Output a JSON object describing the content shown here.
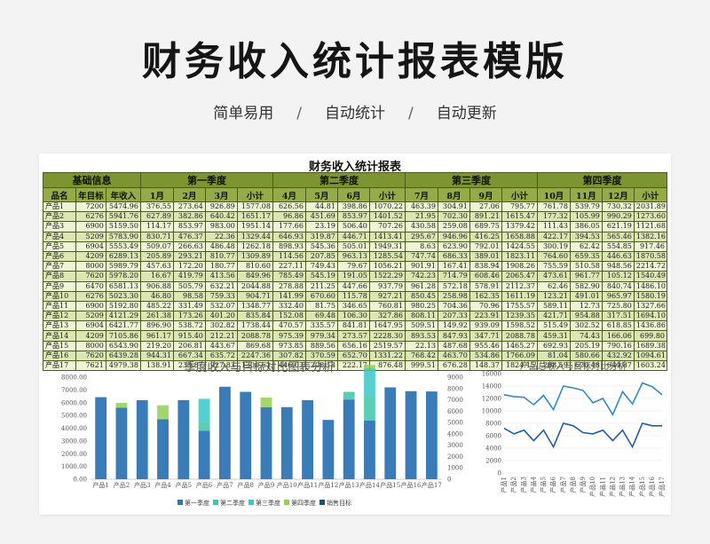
{
  "page": {
    "title": "财务收入统计报表模版",
    "features": [
      "简单易用",
      "自动统计",
      "自动更新"
    ],
    "separator": "/"
  },
  "sheet": {
    "title": "财务收入统计报表",
    "groups": [
      "基础信息",
      "第一季度",
      "第二季度",
      "第三季度",
      "第四季度"
    ],
    "columns": [
      "品名",
      "年目标",
      "年收入",
      "1月",
      "2月",
      "3月",
      "小计",
      "4月",
      "5月",
      "6月",
      "小计",
      "7月",
      "8月",
      "9月",
      "小计",
      "10月",
      "11月",
      "12月",
      "小计"
    ],
    "rows": [
      [
        "产品1",
        "7200",
        "5474.96",
        "376.55",
        "273.64",
        "926.89",
        "1577.08",
        "626.56",
        "44.81",
        "398.86",
        "1070.22",
        "463.39",
        "304.91",
        "27.06",
        "795.77",
        "761.78",
        "539.79",
        "730.32",
        "2031.89"
      ],
      [
        "产品2",
        "6276",
        "5941.76",
        "627.89",
        "382.86",
        "640.42",
        "1651.17",
        "96.86",
        "451.69",
        "853.97",
        "1401.52",
        "21.95",
        "702.30",
        "891.21",
        "1615.47",
        "177.32",
        "105.99",
        "990.29",
        "1273.60"
      ],
      [
        "产品3",
        "6900",
        "5159.50",
        "114.17",
        "853.97",
        "983.00",
        "1951.14",
        "177.66",
        "23.19",
        "506.40",
        "707.26",
        "430.58",
        "259.08",
        "689.75",
        "1379.42",
        "111.43",
        "386.05",
        "621.19",
        "1121.68"
      ],
      [
        "产品4",
        "5209",
        "5783.90",
        "830.71",
        "476.37",
        "22.36",
        "1329.44",
        "646.93",
        "319.87",
        "446.71",
        "1413.41",
        "295.67",
        "946.96",
        "416.25",
        "1658.88",
        "422.17",
        "394.53",
        "565.46",
        "1382.16"
      ],
      [
        "产品5",
        "6904",
        "5553.49",
        "509.07",
        "266.63",
        "486.48",
        "1262.18",
        "898.93",
        "545.36",
        "505.01",
        "1949.31",
        "8.63",
        "623.90",
        "792.01",
        "1424.55",
        "300.19",
        "62.42",
        "554.85",
        "917.46"
      ],
      [
        "产品6",
        "4209",
        "6289.13",
        "205.89",
        "293.21",
        "810.77",
        "1309.89",
        "114.56",
        "207.85",
        "963.13",
        "1285.54",
        "747.74",
        "686.33",
        "389.01",
        "1823.11",
        "764.60",
        "659.35",
        "446.63",
        "1870.58"
      ],
      [
        "产品7",
        "8000",
        "5989.79",
        "457.63",
        "172.20",
        "180.77",
        "810.60",
        "227.11",
        "749.43",
        "79.67",
        "1056.21",
        "901.91",
        "167.41",
        "838.94",
        "1908.26",
        "755.59",
        "510.58",
        "948.56",
        "2214.72"
      ],
      [
        "产品8",
        "7620",
        "5978.20",
        "16.67",
        "419.79",
        "413.56",
        "849.96",
        "785.49",
        "545.19",
        "191.05",
        "1522.29",
        "742.23",
        "714.79",
        "608.46",
        "2065.47",
        "473.61",
        "961.77",
        "105.12",
        "1540.49"
      ],
      [
        "产品9",
        "6470",
        "6581.13",
        "906.88",
        "505.79",
        "632.21",
        "2044.88",
        "278.88",
        "211.25",
        "447.66",
        "937.79",
        "961.28",
        "572.18",
        "578.91",
        "2112.37",
        "62.46",
        "582.90",
        "840.74",
        "1486.10"
      ],
      [
        "产品10",
        "6276",
        "5023.30",
        "46.80",
        "98.58",
        "759.33",
        "904.71",
        "141.99",
        "670.60",
        "115.78",
        "927.21",
        "850.45",
        "258.98",
        "162.35",
        "1611.19",
        "123.21",
        "491.01",
        "965.97",
        "1580.19"
      ],
      [
        "产品11",
        "6900",
        "5192.80",
        "485.22",
        "331.49",
        "532.07",
        "1348.77",
        "332.40",
        "81.75",
        "346.65",
        "760.81",
        "980.25",
        "704.36",
        "70.96",
        "1755.57",
        "589.11",
        "12.73",
        "725.80",
        "1327.66"
      ],
      [
        "产品12",
        "5209",
        "4121.29",
        "261.38",
        "173.26",
        "401.20",
        "835.84",
        "152.08",
        "69.48",
        "106.30",
        "327.86",
        "808.11",
        "207.33",
        "223.91",
        "1239.35",
        "421.71",
        "954.88",
        "317.51",
        "1694.10"
      ],
      [
        "产品13",
        "6904",
        "6421.77",
        "896.90",
        "538.72",
        "302.82",
        "1738.44",
        "470.57",
        "335.57",
        "841.81",
        "1647.95",
        "509.51",
        "149.92",
        "939.09",
        "1598.52",
        "515.49",
        "302.52",
        "618.85",
        "1436.86"
      ],
      [
        "产品14",
        "4209",
        "7105.86",
        "961.17",
        "915.40",
        "212.21",
        "2088.78",
        "975.39",
        "979.34",
        "273.57",
        "2228.30",
        "893.53",
        "847.93",
        "347.71",
        "2088.78",
        "459.31",
        "74.43",
        "166.06",
        "699.80"
      ],
      [
        "产品15",
        "8000",
        "6543.90",
        "219.20",
        "206.81",
        "443.67",
        "869.68",
        "973.85",
        "889.56",
        "656.16",
        "2519.57",
        "22.13",
        "487.68",
        "955.46",
        "1465.27",
        "692.93",
        "205.19",
        "790.16",
        "1689.38"
      ],
      [
        "产品16",
        "7620",
        "6439.28",
        "944.31",
        "667.34",
        "635.72",
        "2247.36",
        "307.82",
        "370.59",
        "652.70",
        "1331.22",
        "768.42",
        "463.70",
        "534.86",
        "1766.09",
        "81.04",
        "580.66",
        "432.92",
        "1094.61"
      ],
      [
        "产品17",
        "7621",
        "4979.38",
        "138.91",
        "233.87",
        "927.83",
        "1300.61",
        "446.03",
        "208.18",
        "222.17",
        "876.48",
        "999.51",
        "676.28",
        "148.37",
        "1824.15",
        "288.59",
        "670.48",
        "644.87",
        "1603.24"
      ]
    ]
  },
  "chart_data": [
    {
      "type": "bar",
      "title": "季度收入与目标对比图表分析",
      "categories": [
        "产品1",
        "产品2",
        "产品3",
        "产品4",
        "产品5",
        "产品6",
        "产品7",
        "产品8",
        "产品9",
        "产品10",
        "产品11",
        "产品12",
        "产品13",
        "产品14",
        "产品15",
        "产品16",
        "产品17"
      ],
      "series": [
        {
          "name": "第一季度",
          "color": "#2e75b6",
          "values": [
            6430,
            5600,
            6200,
            4700,
            6200,
            3800,
            7250,
            6850,
            5650,
            5650,
            6200,
            4650,
            6250,
            4600,
            7200,
            6900,
            6880
          ]
        },
        {
          "name": "第二季度",
          "color": "#3cc6a8",
          "values": [
            0,
            0,
            0,
            0,
            0,
            700,
            0,
            0,
            0,
            0,
            0,
            0,
            600,
            1800,
            0,
            0,
            0
          ]
        },
        {
          "name": "第三季度",
          "color": "#36c9c6",
          "values": [
            0,
            0,
            0,
            0,
            0,
            1800,
            0,
            0,
            0,
            0,
            0,
            0,
            0,
            2300,
            0,
            0,
            0
          ]
        },
        {
          "name": "第四季度",
          "color": "#92d050",
          "values": [
            0,
            380,
            0,
            1100,
            0,
            0,
            0,
            0,
            750,
            0,
            0,
            0,
            0,
            250,
            0,
            0,
            0
          ]
        },
        {
          "name": "销售目标",
          "color": "#1f4e79",
          "values": [
            0,
            0,
            0,
            0,
            0,
            0,
            0,
            0,
            0,
            0,
            0,
            0,
            0,
            0,
            0,
            0,
            0
          ]
        }
      ],
      "y_left": {
        "ticks": [
          "0.00",
          "1000.00",
          "2000.00",
          "3000.00",
          "4000.00",
          "5000.00",
          "6000.00",
          "7000.00",
          "8000.00"
        ],
        "range": [
          0,
          8000
        ]
      },
      "y_right": {
        "ticks": [
          "0",
          "1000",
          "2000",
          "3000",
          "4000",
          "5000",
          "6000",
          "7000",
          "8000",
          "9000"
        ],
        "range": [
          0,
          9000
        ]
      },
      "legend": "bottom"
    },
    {
      "type": "line",
      "title": "产品总收入与目标对比分析",
      "categories": [
        "产品1",
        "产品2",
        "产品3",
        "产品4",
        "产品5",
        "产品6",
        "产品7",
        "产品8",
        "产品9",
        "产品10",
        "产品11",
        "产品12",
        "产品13",
        "产品14",
        "产品15",
        "产品16",
        "产品17"
      ],
      "series": [
        {
          "color": "#2e8bc9",
          "values": [
            12600,
            12300,
            12200,
            11000,
            12500,
            10200,
            14000,
            13700,
            13300,
            11300,
            12000,
            9400,
            13100,
            11100,
            14500,
            13900,
            12600
          ]
        },
        {
          "color": "#1f5ea8",
          "values": [
            7200,
            6300,
            6900,
            5200,
            6900,
            4200,
            8000,
            7600,
            6500,
            6300,
            6900,
            5200,
            6900,
            4200,
            8000,
            7600,
            7600
          ]
        }
      ],
      "y": {
        "ticks": [
          "0",
          "2000",
          "4000",
          "6000",
          "8000",
          "10000",
          "12000",
          "14000",
          "16000"
        ],
        "range": [
          0,
          16000
        ]
      },
      "legend": "none"
    }
  ]
}
